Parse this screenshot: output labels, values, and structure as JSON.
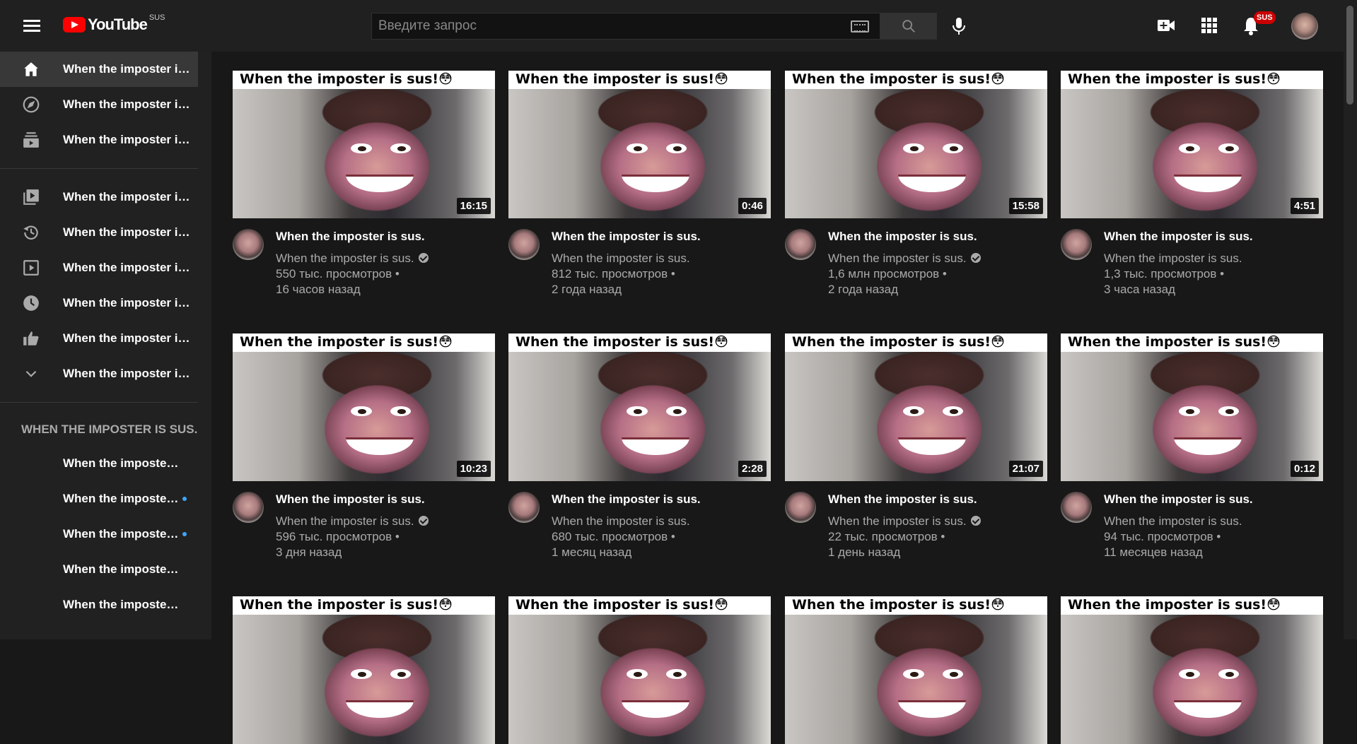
{
  "header": {
    "logo_text": "YouTube",
    "logo_sup": "SUS",
    "search_placeholder": "Введите запрос",
    "notifications_badge": "SUS"
  },
  "sidebar": {
    "primary": [
      {
        "label": "When the imposter is sus.",
        "icon": "home-icon",
        "active": true
      },
      {
        "label": "When the imposter is sus.",
        "icon": "explore-compass-icon"
      },
      {
        "label": "When the imposter is sus.",
        "icon": "subscriptions-icon"
      }
    ],
    "library": [
      {
        "label": "When the imposter is sus.",
        "icon": "library-icon"
      },
      {
        "label": "When the imposter is sus.",
        "icon": "history-icon"
      },
      {
        "label": "When the imposter is sus.",
        "icon": "your-videos-icon"
      },
      {
        "label": "When the imposter is sus.",
        "icon": "watch-later-icon"
      },
      {
        "label": "When the imposter is sus.",
        "icon": "liked-videos-icon"
      },
      {
        "label": "When the imposter is sus.",
        "icon": "chevron-down-icon"
      }
    ],
    "subscriptions_heading": "WHEN THE IMPOSTER IS SUS.",
    "subscriptions": [
      {
        "label": "When the imposter is sus.",
        "dot": false
      },
      {
        "label": "When the imposter is sus.",
        "dot": true
      },
      {
        "label": "When the imposter is sus.",
        "dot": true
      },
      {
        "label": "When the imposter is sus.",
        "dot": false
      },
      {
        "label": "When the imposter is sus.",
        "dot": false
      }
    ]
  },
  "thumbnail_caption": "When the imposter is sus!😳",
  "videos": [
    {
      "title": "When the imposter is sus.",
      "channel": "When the imposter is sus.",
      "verified": true,
      "views": "550 тыс. просмотров •",
      "ago": "16 часов назад",
      "duration": "16:15"
    },
    {
      "title": "When the imposter is sus.",
      "channel": "When the imposter is sus.",
      "verified": false,
      "views": "812 тыс. просмотров •",
      "ago": "2 года назад",
      "duration": "0:46"
    },
    {
      "title": "When the imposter is sus.",
      "channel": "When the imposter is sus.",
      "verified": true,
      "views": "1,6 млн просмотров •",
      "ago": "2 года назад",
      "duration": "15:58"
    },
    {
      "title": "When the imposter is sus.",
      "channel": "When the imposter is sus.",
      "verified": false,
      "views": "1,3 тыс. просмотров •",
      "ago": "3 часа назад",
      "duration": "4:51"
    },
    {
      "title": "When the imposter is sus.",
      "channel": "When the imposter is sus.",
      "verified": true,
      "views": "596 тыс. просмотров •",
      "ago": "3 дня назад",
      "duration": "10:23"
    },
    {
      "title": "When the imposter is sus.",
      "channel": "When the imposter is sus.",
      "verified": false,
      "views": "680 тыс. просмотров •",
      "ago": "1 месяц назад",
      "duration": "2:28"
    },
    {
      "title": "When the imposter is sus.",
      "channel": "When the imposter is sus.",
      "verified": true,
      "views": "22 тыс. просмотров •",
      "ago": "1 день назад",
      "duration": "21:07"
    },
    {
      "title": "When the imposter is sus.",
      "channel": "When the imposter is sus.",
      "verified": false,
      "views": "94 тыс. просмотров •",
      "ago": "11 месяцев назад",
      "duration": "0:12"
    }
  ],
  "colors": {
    "background": "#181818",
    "sidebar": "#212121",
    "topbar": "#202020",
    "brand_red": "#ff0000",
    "badge_red": "#cc0000",
    "unread_dot": "#3ea6ff"
  }
}
